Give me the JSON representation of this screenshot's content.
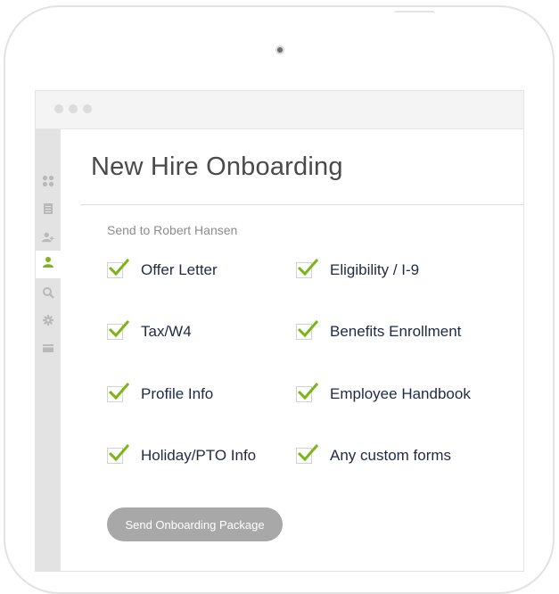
{
  "page": {
    "title": "New Hire Onboarding",
    "send_to": "Send to Robert Hansen"
  },
  "sidebar": {
    "icons": [
      "apps-grid-icon",
      "document-icon",
      "users-icon",
      "user-icon",
      "search-icon",
      "gear-icon",
      "card-icon"
    ],
    "active": "user-icon"
  },
  "checklist": [
    {
      "label": "Offer Letter",
      "checked": true
    },
    {
      "label": "Eligibility / I-9",
      "checked": true
    },
    {
      "label": "Tax/W4",
      "checked": true
    },
    {
      "label": "Benefits Enrollment",
      "checked": true
    },
    {
      "label": "Profile Info",
      "checked": true
    },
    {
      "label": "Employee Handbook",
      "checked": true
    },
    {
      "label": "Holiday/PTO Info",
      "checked": true
    },
    {
      "label": "Any custom forms",
      "checked": true
    }
  ],
  "actions": {
    "send_label": "Send Onboarding Package"
  },
  "colors": {
    "check": "#7cb518",
    "active_icon": "#7cb518",
    "button_bg": "#a8a8a8",
    "label_text": "#1f2a44"
  }
}
